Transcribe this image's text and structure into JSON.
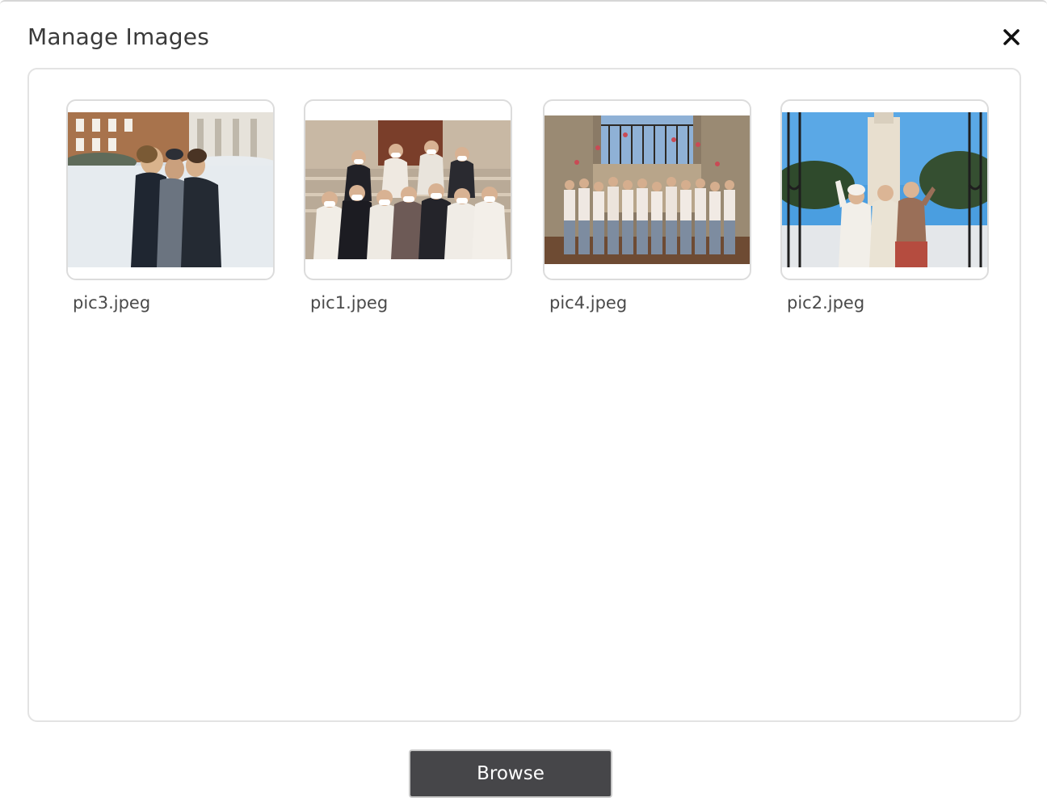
{
  "dialog": {
    "title": "Manage Images",
    "close_icon": "close-icon"
  },
  "images": [
    {
      "file_name": "pic3.jpeg",
      "scene": "three friends in snow, brick building behind"
    },
    {
      "file_name": "pic1.jpeg",
      "scene": "group of masked women seated on steps"
    },
    {
      "file_name": "pic4.jpeg",
      "scene": "large masked group in front of iron gate"
    },
    {
      "file_name": "pic2.jpeg",
      "scene": "three friends in winter coats, tower behind"
    }
  ],
  "footer": {
    "browse_label": "Browse"
  },
  "colors": {
    "title_text": "#3a3a3a",
    "border": "#e3e3e3",
    "button_bg": "#464649",
    "button_text": "#ffffff"
  }
}
